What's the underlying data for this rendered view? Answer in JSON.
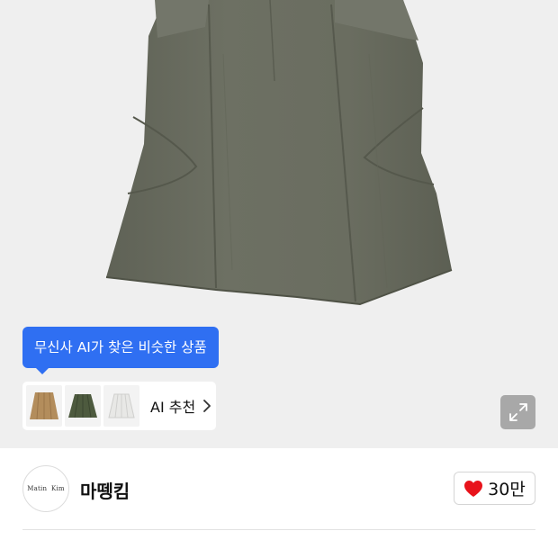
{
  "ai_recommendation": {
    "tooltip": "무신사 AI가 찾은 비슷한 상품",
    "label": "AI 추천",
    "thumbnails": [
      {
        "name": "beige-skirt",
        "color": "#b38d5c"
      },
      {
        "name": "khaki-skirt",
        "color": "#4d5a3e"
      },
      {
        "name": "white-skirt",
        "color": "#e8e8e6"
      }
    ]
  },
  "product_image": {
    "main_color": "#6a6d60"
  },
  "brand": {
    "logo_text": "Matin  Kim",
    "name": "마뗑킴"
  },
  "like": {
    "count": "30만",
    "heart_color": "#e8131b"
  },
  "accent_color": "#2f6ff2",
  "next_line_text": ""
}
